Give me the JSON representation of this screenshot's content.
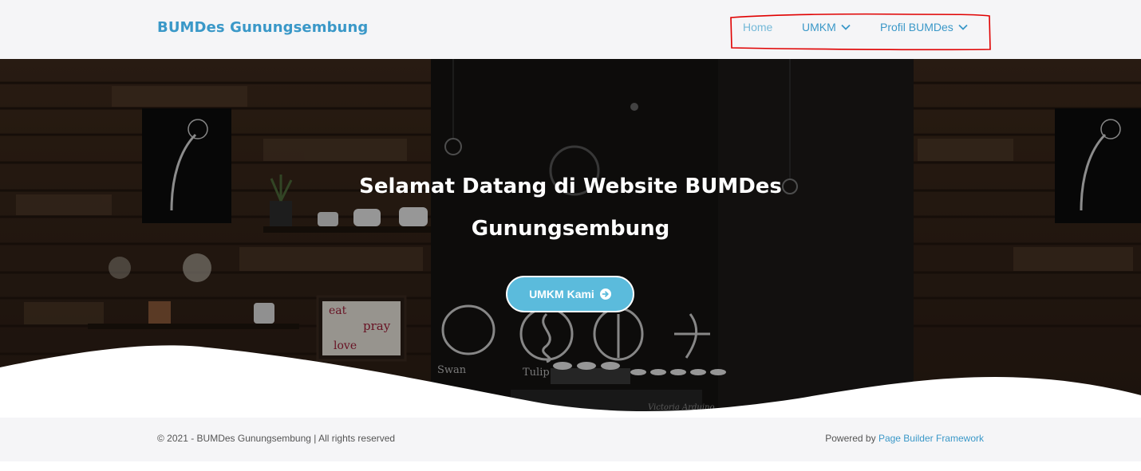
{
  "header": {
    "brand": "BUMDes Gunungsembung",
    "nav": [
      {
        "label": "Home"
      },
      {
        "label": "UMKM"
      },
      {
        "label": "Profil BUMDes"
      }
    ]
  },
  "hero": {
    "title_line1": "Selamat Datang di Website BUMDes",
    "title_line2": "Gunungsembung",
    "cta_label": "UMKM Kami",
    "board_words": [
      "eat",
      "pray",
      "love"
    ],
    "latte_labels": [
      "Swan",
      "Tulip",
      "Victoria Arduino"
    ]
  },
  "footer": {
    "copyright": "© 2021 - BUMDes Gunungsembung | All rights reserved",
    "powered_prefix": "Powered by ",
    "powered_link": "Page Builder Framework"
  },
  "colors": {
    "brand": "#3a98c8",
    "cta": "#5bbbdc",
    "annotation": "#e00000"
  }
}
